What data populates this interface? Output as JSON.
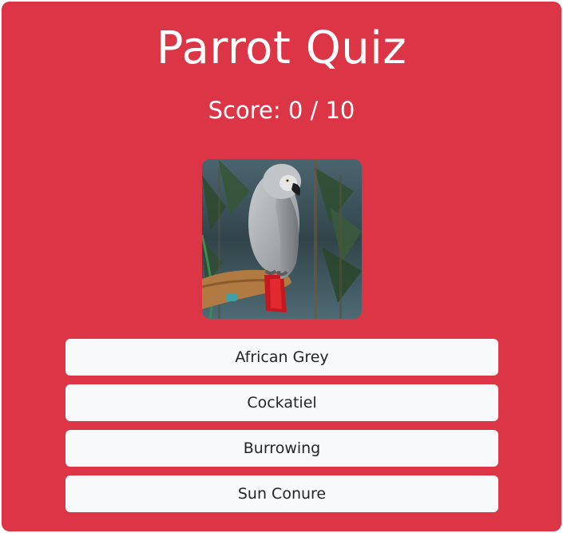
{
  "quiz": {
    "title": "Parrot Quiz",
    "score_label": "Score: 0 / 10",
    "score": 0,
    "total": 10
  },
  "photo": {
    "alt": "African Grey parrot"
  },
  "options": [
    {
      "label": "African Grey"
    },
    {
      "label": "Cockatiel"
    },
    {
      "label": "Burrowing"
    },
    {
      "label": "Sun Conure"
    }
  ],
  "colors": {
    "card": "#dc3545",
    "title_text": "#ffffff",
    "option_bg": "#f8f9fa",
    "option_text": "#212529"
  }
}
